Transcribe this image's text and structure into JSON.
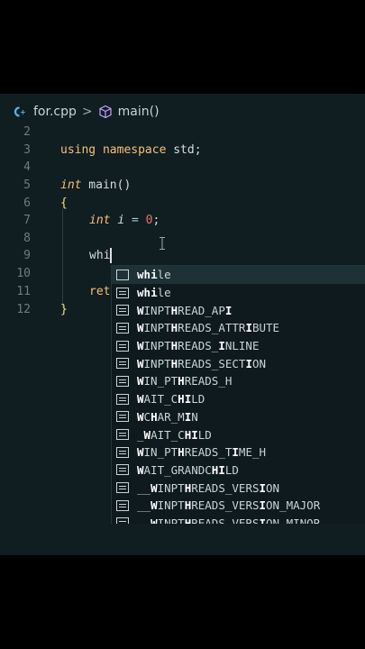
{
  "breadcrumb": {
    "file": "for.cpp",
    "separator": ">",
    "symbol": "main()"
  },
  "lines": [
    {
      "num": "2"
    },
    {
      "num": "3",
      "code": "using namespace std;"
    },
    {
      "num": "4"
    },
    {
      "num": "5",
      "code": "int main()"
    },
    {
      "num": "6",
      "code": "{"
    },
    {
      "num": "7",
      "code": "int i = 0;"
    },
    {
      "num": "8"
    },
    {
      "num": "9",
      "code": "whi"
    },
    {
      "num": "10"
    },
    {
      "num": "11",
      "code": "ret"
    },
    {
      "num": "12",
      "code": "}"
    }
  ],
  "suggestions": [
    {
      "label": "while",
      "kind": "keyword",
      "selected": true
    },
    {
      "label": "while",
      "kind": "snippet"
    },
    {
      "label": "WINPTHREAD_API",
      "kind": "constant"
    },
    {
      "label": "WINPTHREADS_ATTRIBUTE",
      "kind": "constant"
    },
    {
      "label": "WINPTHREADS_INLINE",
      "kind": "constant"
    },
    {
      "label": "WINPTHREADS_SECTION",
      "kind": "constant"
    },
    {
      "label": "WIN_PTHREADS_H",
      "kind": "constant"
    },
    {
      "label": "WAIT_CHILD",
      "kind": "constant"
    },
    {
      "label": "WCHAR_MIN",
      "kind": "constant"
    },
    {
      "label": "_WAIT_CHILD",
      "kind": "constant"
    },
    {
      "label": "WIN_PTHREADS_TIME_H",
      "kind": "constant"
    },
    {
      "label": "WAIT_GRANDCHILD",
      "kind": "constant"
    },
    {
      "label": "__WINPTHREADS_VERSION",
      "kind": "constant"
    },
    {
      "label": "__WINPTHREADS_VERSION_MAJOR",
      "kind": "constant"
    },
    {
      "label": "__WINPTHREADS_VERSION_MINOR",
      "kind": "constant"
    }
  ],
  "colors": {
    "editor_bg": "#101d21",
    "keyword": "#f6c177",
    "number": "#e57373",
    "accent_blue": "#5ab4e6"
  }
}
